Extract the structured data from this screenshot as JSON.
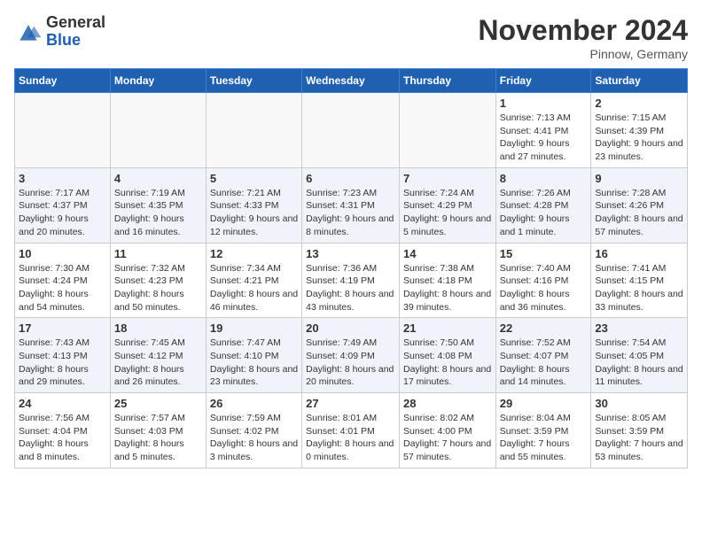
{
  "header": {
    "logo_general": "General",
    "logo_blue": "Blue",
    "month_title": "November 2024",
    "location": "Pinnow, Germany"
  },
  "days_of_week": [
    "Sunday",
    "Monday",
    "Tuesday",
    "Wednesday",
    "Thursday",
    "Friday",
    "Saturday"
  ],
  "weeks": [
    [
      {
        "day": "",
        "info": ""
      },
      {
        "day": "",
        "info": ""
      },
      {
        "day": "",
        "info": ""
      },
      {
        "day": "",
        "info": ""
      },
      {
        "day": "",
        "info": ""
      },
      {
        "day": "1",
        "info": "Sunrise: 7:13 AM\nSunset: 4:41 PM\nDaylight: 9 hours and 27 minutes."
      },
      {
        "day": "2",
        "info": "Sunrise: 7:15 AM\nSunset: 4:39 PM\nDaylight: 9 hours and 23 minutes."
      }
    ],
    [
      {
        "day": "3",
        "info": "Sunrise: 7:17 AM\nSunset: 4:37 PM\nDaylight: 9 hours and 20 minutes."
      },
      {
        "day": "4",
        "info": "Sunrise: 7:19 AM\nSunset: 4:35 PM\nDaylight: 9 hours and 16 minutes."
      },
      {
        "day": "5",
        "info": "Sunrise: 7:21 AM\nSunset: 4:33 PM\nDaylight: 9 hours and 12 minutes."
      },
      {
        "day": "6",
        "info": "Sunrise: 7:23 AM\nSunset: 4:31 PM\nDaylight: 9 hours and 8 minutes."
      },
      {
        "day": "7",
        "info": "Sunrise: 7:24 AM\nSunset: 4:29 PM\nDaylight: 9 hours and 5 minutes."
      },
      {
        "day": "8",
        "info": "Sunrise: 7:26 AM\nSunset: 4:28 PM\nDaylight: 9 hours and 1 minute."
      },
      {
        "day": "9",
        "info": "Sunrise: 7:28 AM\nSunset: 4:26 PM\nDaylight: 8 hours and 57 minutes."
      }
    ],
    [
      {
        "day": "10",
        "info": "Sunrise: 7:30 AM\nSunset: 4:24 PM\nDaylight: 8 hours and 54 minutes."
      },
      {
        "day": "11",
        "info": "Sunrise: 7:32 AM\nSunset: 4:23 PM\nDaylight: 8 hours and 50 minutes."
      },
      {
        "day": "12",
        "info": "Sunrise: 7:34 AM\nSunset: 4:21 PM\nDaylight: 8 hours and 46 minutes."
      },
      {
        "day": "13",
        "info": "Sunrise: 7:36 AM\nSunset: 4:19 PM\nDaylight: 8 hours and 43 minutes."
      },
      {
        "day": "14",
        "info": "Sunrise: 7:38 AM\nSunset: 4:18 PM\nDaylight: 8 hours and 39 minutes."
      },
      {
        "day": "15",
        "info": "Sunrise: 7:40 AM\nSunset: 4:16 PM\nDaylight: 8 hours and 36 minutes."
      },
      {
        "day": "16",
        "info": "Sunrise: 7:41 AM\nSunset: 4:15 PM\nDaylight: 8 hours and 33 minutes."
      }
    ],
    [
      {
        "day": "17",
        "info": "Sunrise: 7:43 AM\nSunset: 4:13 PM\nDaylight: 8 hours and 29 minutes."
      },
      {
        "day": "18",
        "info": "Sunrise: 7:45 AM\nSunset: 4:12 PM\nDaylight: 8 hours and 26 minutes."
      },
      {
        "day": "19",
        "info": "Sunrise: 7:47 AM\nSunset: 4:10 PM\nDaylight: 8 hours and 23 minutes."
      },
      {
        "day": "20",
        "info": "Sunrise: 7:49 AM\nSunset: 4:09 PM\nDaylight: 8 hours and 20 minutes."
      },
      {
        "day": "21",
        "info": "Sunrise: 7:50 AM\nSunset: 4:08 PM\nDaylight: 8 hours and 17 minutes."
      },
      {
        "day": "22",
        "info": "Sunrise: 7:52 AM\nSunset: 4:07 PM\nDaylight: 8 hours and 14 minutes."
      },
      {
        "day": "23",
        "info": "Sunrise: 7:54 AM\nSunset: 4:05 PM\nDaylight: 8 hours and 11 minutes."
      }
    ],
    [
      {
        "day": "24",
        "info": "Sunrise: 7:56 AM\nSunset: 4:04 PM\nDaylight: 8 hours and 8 minutes."
      },
      {
        "day": "25",
        "info": "Sunrise: 7:57 AM\nSunset: 4:03 PM\nDaylight: 8 hours and 5 minutes."
      },
      {
        "day": "26",
        "info": "Sunrise: 7:59 AM\nSunset: 4:02 PM\nDaylight: 8 hours and 3 minutes."
      },
      {
        "day": "27",
        "info": "Sunrise: 8:01 AM\nSunset: 4:01 PM\nDaylight: 8 hours and 0 minutes."
      },
      {
        "day": "28",
        "info": "Sunrise: 8:02 AM\nSunset: 4:00 PM\nDaylight: 7 hours and 57 minutes."
      },
      {
        "day": "29",
        "info": "Sunrise: 8:04 AM\nSunset: 3:59 PM\nDaylight: 7 hours and 55 minutes."
      },
      {
        "day": "30",
        "info": "Sunrise: 8:05 AM\nSunset: 3:59 PM\nDaylight: 7 hours and 53 minutes."
      }
    ]
  ]
}
